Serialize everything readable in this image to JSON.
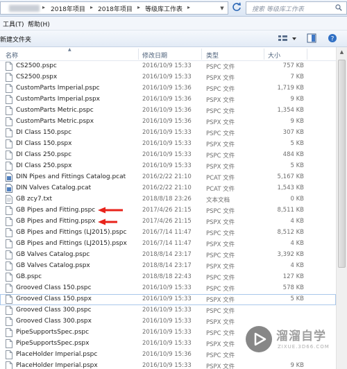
{
  "address": {
    "crumbs": [
      "2018年项目",
      "2018年项目",
      "等级库工作表"
    ],
    "search_placeholder": "搜索 等级库工作表"
  },
  "menu": {
    "items": [
      "工具(T)",
      "帮助(H)"
    ]
  },
  "toolbar": {
    "new_folder": "新建文件夹"
  },
  "columns": {
    "name": "名称",
    "date": "修改日期",
    "type": "类型",
    "size": "大小"
  },
  "files": [
    {
      "name": "CS2500.pspc",
      "date": "2016/10/9 15:33",
      "type": "PSPC 文件",
      "size": "757 KB",
      "icon": "file-icon"
    },
    {
      "name": "CS2500.pspx",
      "date": "2016/10/9 15:33",
      "type": "PSPX 文件",
      "size": "7 KB",
      "icon": "file-icon"
    },
    {
      "name": "CustomParts Imperial.pspc",
      "date": "2016/10/9 15:36",
      "type": "PSPC 文件",
      "size": "1,719 KB",
      "icon": "file-icon"
    },
    {
      "name": "CustomParts Imperial.pspx",
      "date": "2016/10/9 15:36",
      "type": "PSPX 文件",
      "size": "9 KB",
      "icon": "file-icon"
    },
    {
      "name": "CustomParts Metric.pspc",
      "date": "2016/10/9 15:36",
      "type": "PSPC 文件",
      "size": "1,354 KB",
      "icon": "file-icon"
    },
    {
      "name": "CustomParts Metric.pspx",
      "date": "2016/10/9 15:36",
      "type": "PSPX 文件",
      "size": "9 KB",
      "icon": "file-icon"
    },
    {
      "name": "DI Class 150.pspc",
      "date": "2016/10/9 15:33",
      "type": "PSPC 文件",
      "size": "307 KB",
      "icon": "file-icon"
    },
    {
      "name": "DI Class 150.pspx",
      "date": "2016/10/9 15:33",
      "type": "PSPX 文件",
      "size": "5 KB",
      "icon": "file-icon"
    },
    {
      "name": "DI Class 250.pspc",
      "date": "2016/10/9 15:33",
      "type": "PSPC 文件",
      "size": "484 KB",
      "icon": "file-icon"
    },
    {
      "name": "DI Class 250.pspx",
      "date": "2016/10/9 15:33",
      "type": "PSPX 文件",
      "size": "5 KB",
      "icon": "file-icon"
    },
    {
      "name": "DIN Pipes and Fittings Catalog.pcat",
      "date": "2016/2/22 21:10",
      "type": "PCAT 文件",
      "size": "5,167 KB",
      "icon": "catalog-file-icon"
    },
    {
      "name": "DIN Valves Catalog.pcat",
      "date": "2016/2/22 21:10",
      "type": "PCAT 文件",
      "size": "1,543 KB",
      "icon": "catalog-file-icon"
    },
    {
      "name": "GB    zcy7.txt",
      "date": "2018/8/18 23:26",
      "type": "文本文档",
      "size": "0 KB",
      "icon": "text-file-icon"
    },
    {
      "name": "GB Pipes and Fitting.pspc",
      "date": "2017/4/26 21:15",
      "type": "PSPC 文件",
      "size": "8,511 KB",
      "icon": "file-icon"
    },
    {
      "name": "GB Pipes and Fitting.pspx",
      "date": "2017/4/26 21:15",
      "type": "PSPX 文件",
      "size": "4 KB",
      "icon": "file-icon"
    },
    {
      "name": "GB Pipes and Fittings (LJ2015).pspc",
      "date": "2016/7/14 11:47",
      "type": "PSPC 文件",
      "size": "8,512 KB",
      "icon": "file-icon"
    },
    {
      "name": "GB Pipes and Fittings (LJ2015).pspx",
      "date": "2016/7/14 11:47",
      "type": "PSPX 文件",
      "size": "4 KB",
      "icon": "file-icon"
    },
    {
      "name": "GB Valves Catalog.pspc",
      "date": "2018/8/14 23:17",
      "type": "PSPC 文件",
      "size": "3,392 KB",
      "icon": "file-icon"
    },
    {
      "name": "GB Valves Catalog.pspx",
      "date": "2018/8/14 23:17",
      "type": "PSPX 文件",
      "size": "4 KB",
      "icon": "file-icon"
    },
    {
      "name": "GB.pspc",
      "date": "2018/8/18 22:43",
      "type": "PSPC 文件",
      "size": "127 KB",
      "icon": "file-icon"
    },
    {
      "name": "Grooved Class 150.pspc",
      "date": "2016/10/9 15:33",
      "type": "PSPC 文件",
      "size": "578 KB",
      "icon": "file-icon"
    },
    {
      "name": "Grooved Class 150.pspx",
      "date": "2016/10/9 15:33",
      "type": "PSPX 文件",
      "size": "5 KB",
      "icon": "file-icon",
      "selected": true
    },
    {
      "name": "Grooved Class 300.pspc",
      "date": "2016/10/9 15:33",
      "type": "PSPC 文件",
      "size": "",
      "icon": "file-icon"
    },
    {
      "name": "Grooved Class 300.pspx",
      "date": "2016/10/9 15:33",
      "type": "PSPX 文件",
      "size": "",
      "icon": "file-icon"
    },
    {
      "name": "PipeSupportsSpec.pspc",
      "date": "2016/10/9 15:33",
      "type": "PSPC 文件",
      "size": "",
      "icon": "file-icon"
    },
    {
      "name": "PipeSupportsSpec.pspx",
      "date": "2016/10/9 15:33",
      "type": "PSPX 文件",
      "size": "",
      "icon": "file-icon"
    },
    {
      "name": "PlaceHolder Imperial.pspc",
      "date": "2016/10/9 15:36",
      "type": "PSPC 文件",
      "size": "",
      "icon": "file-icon"
    },
    {
      "name": "PlaceHolder Imperial.pspx",
      "date": "2016/10/9 15:33",
      "type": "PSPX 文件",
      "size": "9 KB",
      "icon": "file-icon"
    }
  ],
  "annotation_color": "#e8231b",
  "watermark": {
    "title": "溜溜自学",
    "subtitle": "ZIXUE.3D66.COM"
  }
}
